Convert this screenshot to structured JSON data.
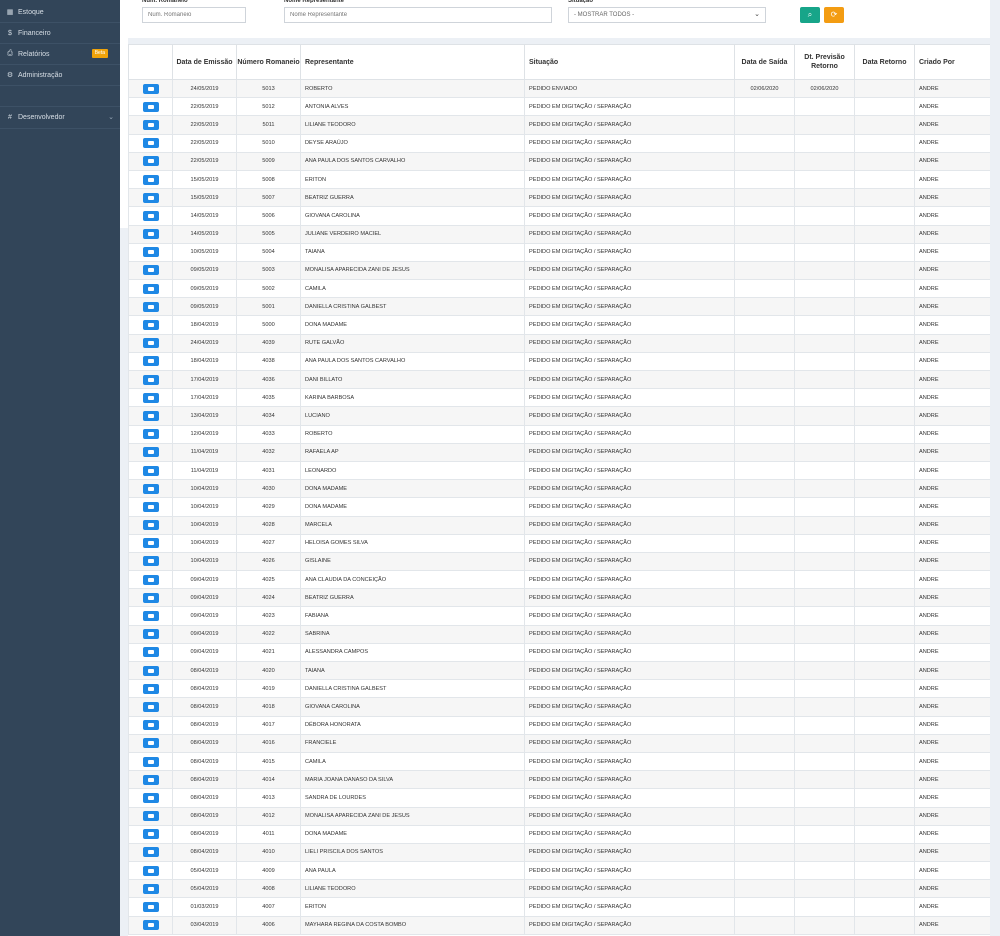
{
  "sidebar": {
    "items": [
      {
        "label": "Estoque",
        "icon": "grid-icon"
      },
      {
        "label": "Financeiro",
        "icon": "dollar-icon"
      },
      {
        "label": "Relatórios",
        "icon": "printer-icon",
        "badge": "Beta"
      },
      {
        "label": "Administração",
        "icon": "gear-icon"
      },
      {
        "label": "Desenvolvedor",
        "icon": "hash-icon"
      }
    ]
  },
  "filters": {
    "romaneio_label": "Num. Romaneio",
    "romaneio_placeholder": "Num. Romaneio",
    "representante_label": "Nome Representante",
    "representante_placeholder": "Nome Representante",
    "situacao_label": "Situação",
    "situacao_selected": "- MOSTRAR TODOS -"
  },
  "colors": {
    "sidebar": "#324559",
    "primary": "#1e88e5",
    "success": "#17a589",
    "warning": "#f39c12"
  },
  "table": {
    "headers": {
      "data_emissao": "Data de Emissão",
      "numero_romaneio": "Número Romaneio",
      "representante": "Representante",
      "situacao": "Situação",
      "data_saida": "Data de Saída",
      "dt_previsao_retorno": "Dt. Previsão Retorno",
      "data_retorno": "Data Retorno",
      "criado_por": "Criado Por"
    },
    "rows": [
      [
        "24/05/2019",
        "5013",
        "ROBERTO",
        "PEDIDO ENVIADO",
        "02/06/2020",
        "02/06/2020",
        "",
        "ANDRE"
      ],
      [
        "22/05/2019",
        "5012",
        "ANTONIA ALVES",
        "PEDIDO EM DIGITAÇÃO / SEPARAÇÃO",
        "",
        "",
        "",
        "ANDRE"
      ],
      [
        "22/05/2019",
        "5011",
        "LILIANE TEODORO",
        "PEDIDO EM DIGITAÇÃO / SEPARAÇÃO",
        "",
        "",
        "",
        "ANDRE"
      ],
      [
        "22/05/2019",
        "5010",
        "DEYSE ARAÚJO",
        "PEDIDO EM DIGITAÇÃO / SEPARAÇÃO",
        "",
        "",
        "",
        "ANDRE"
      ],
      [
        "22/05/2019",
        "5009",
        "ANA PAULA DOS SANTOS CARVALHO",
        "PEDIDO EM DIGITAÇÃO / SEPARAÇÃO",
        "",
        "",
        "",
        "ANDRE"
      ],
      [
        "15/05/2019",
        "5008",
        "ERITON",
        "PEDIDO EM DIGITAÇÃO / SEPARAÇÃO",
        "",
        "",
        "",
        "ANDRE"
      ],
      [
        "15/05/2019",
        "5007",
        "BEATRIZ GUERRA",
        "PEDIDO EM DIGITAÇÃO / SEPARAÇÃO",
        "",
        "",
        "",
        "ANDRE"
      ],
      [
        "14/05/2019",
        "5006",
        "GIOVANA CAROLINA",
        "PEDIDO EM DIGITAÇÃO / SEPARAÇÃO",
        "",
        "",
        "",
        "ANDRE"
      ],
      [
        "14/05/2019",
        "5005",
        "JULIANE VERDEIRO MACIEL",
        "PEDIDO EM DIGITAÇÃO / SEPARAÇÃO",
        "",
        "",
        "",
        "ANDRE"
      ],
      [
        "10/05/2019",
        "5004",
        "TAIANA",
        "PEDIDO EM DIGITAÇÃO / SEPARAÇÃO",
        "",
        "",
        "",
        "ANDRE"
      ],
      [
        "09/05/2019",
        "5003",
        "MONALISA APARECIDA ZANI DE JESUS",
        "PEDIDO EM DIGITAÇÃO / SEPARAÇÃO",
        "",
        "",
        "",
        "ANDRE"
      ],
      [
        "09/05/2019",
        "5002",
        "CAMILA",
        "PEDIDO EM DIGITAÇÃO / SEPARAÇÃO",
        "",
        "",
        "",
        "ANDRE"
      ],
      [
        "09/05/2019",
        "5001",
        "DANIELLA CRISTINA GALBEST",
        "PEDIDO EM DIGITAÇÃO / SEPARAÇÃO",
        "",
        "",
        "",
        "ANDRE"
      ],
      [
        "18/04/2019",
        "5000",
        "DONA MADAME",
        "PEDIDO EM DIGITAÇÃO / SEPARAÇÃO",
        "",
        "",
        "",
        "ANDRE"
      ],
      [
        "24/04/2019",
        "4039",
        "RUTE GALVÃO",
        "PEDIDO EM DIGITAÇÃO / SEPARAÇÃO",
        "",
        "",
        "",
        "ANDRE"
      ],
      [
        "18/04/2019",
        "4038",
        "ANA PAULA DOS SANTOS CARVALHO",
        "PEDIDO EM DIGITAÇÃO / SEPARAÇÃO",
        "",
        "",
        "",
        "ANDRE"
      ],
      [
        "17/04/2019",
        "4036",
        "DANI BILLATO",
        "PEDIDO EM DIGITAÇÃO / SEPARAÇÃO",
        "",
        "",
        "",
        "ANDRE"
      ],
      [
        "17/04/2019",
        "4035",
        "KARINA BARBOSA",
        "PEDIDO EM DIGITAÇÃO / SEPARAÇÃO",
        "",
        "",
        "",
        "ANDRE"
      ],
      [
        "13/04/2019",
        "4034",
        "LUCIANO",
        "PEDIDO EM DIGITAÇÃO / SEPARAÇÃO",
        "",
        "",
        "",
        "ANDRE"
      ],
      [
        "12/04/2019",
        "4033",
        "ROBERTO",
        "PEDIDO EM DIGITAÇÃO / SEPARAÇÃO",
        "",
        "",
        "",
        "ANDRE"
      ],
      [
        "11/04/2019",
        "4032",
        "RAFAELA AP",
        "PEDIDO EM DIGITAÇÃO / SEPARAÇÃO",
        "",
        "",
        "",
        "ANDRE"
      ],
      [
        "11/04/2019",
        "4031",
        "LEONARDO",
        "PEDIDO EM DIGITAÇÃO / SEPARAÇÃO",
        "",
        "",
        "",
        "ANDRE"
      ],
      [
        "10/04/2019",
        "4030",
        "DONA MADAME",
        "PEDIDO EM DIGITAÇÃO / SEPARAÇÃO",
        "",
        "",
        "",
        "ANDRE"
      ],
      [
        "10/04/2019",
        "4029",
        "DONA MADAME",
        "PEDIDO EM DIGITAÇÃO / SEPARAÇÃO",
        "",
        "",
        "",
        "ANDRE"
      ],
      [
        "10/04/2019",
        "4028",
        "MARCELA",
        "PEDIDO EM DIGITAÇÃO / SEPARAÇÃO",
        "",
        "",
        "",
        "ANDRE"
      ],
      [
        "10/04/2019",
        "4027",
        "HELOISA GOMES SILVA",
        "PEDIDO EM DIGITAÇÃO / SEPARAÇÃO",
        "",
        "",
        "",
        "ANDRE"
      ],
      [
        "10/04/2019",
        "4026",
        "GISLAINE",
        "PEDIDO EM DIGITAÇÃO / SEPARAÇÃO",
        "",
        "",
        "",
        "ANDRE"
      ],
      [
        "09/04/2019",
        "4025",
        "ANA CLAUDIA DA CONCEIÇÃO",
        "PEDIDO EM DIGITAÇÃO / SEPARAÇÃO",
        "",
        "",
        "",
        "ANDRE"
      ],
      [
        "09/04/2019",
        "4024",
        "BEATRIZ GUERRA",
        "PEDIDO EM DIGITAÇÃO / SEPARAÇÃO",
        "",
        "",
        "",
        "ANDRE"
      ],
      [
        "09/04/2019",
        "4023",
        "FABIANA",
        "PEDIDO EM DIGITAÇÃO / SEPARAÇÃO",
        "",
        "",
        "",
        "ANDRE"
      ],
      [
        "09/04/2019",
        "4022",
        "SABRINA",
        "PEDIDO EM DIGITAÇÃO / SEPARAÇÃO",
        "",
        "",
        "",
        "ANDRE"
      ],
      [
        "09/04/2019",
        "4021",
        "ALESSANDRA CAMPOS",
        "PEDIDO EM DIGITAÇÃO / SEPARAÇÃO",
        "",
        "",
        "",
        "ANDRE"
      ],
      [
        "08/04/2019",
        "4020",
        "TAIANA",
        "PEDIDO EM DIGITAÇÃO / SEPARAÇÃO",
        "",
        "",
        "",
        "ANDRE"
      ],
      [
        "08/04/2019",
        "4019",
        "DANIELLA CRISTINA GALBEST",
        "PEDIDO EM DIGITAÇÃO / SEPARAÇÃO",
        "",
        "",
        "",
        "ANDRE"
      ],
      [
        "08/04/2019",
        "4018",
        "GIOVANA CAROLINA",
        "PEDIDO EM DIGITAÇÃO / SEPARAÇÃO",
        "",
        "",
        "",
        "ANDRE"
      ],
      [
        "08/04/2019",
        "4017",
        "DÉBORA HONORATA",
        "PEDIDO EM DIGITAÇÃO / SEPARAÇÃO",
        "",
        "",
        "",
        "ANDRE"
      ],
      [
        "08/04/2019",
        "4016",
        "FRANCIELE",
        "PEDIDO EM DIGITAÇÃO / SEPARAÇÃO",
        "",
        "",
        "",
        "ANDRE"
      ],
      [
        "08/04/2019",
        "4015",
        "CAMILA",
        "PEDIDO EM DIGITAÇÃO / SEPARAÇÃO",
        "",
        "",
        "",
        "ANDRE"
      ],
      [
        "08/04/2019",
        "4014",
        "MARIA JOANA DANASO DA SILVA",
        "PEDIDO EM DIGITAÇÃO / SEPARAÇÃO",
        "",
        "",
        "",
        "ANDRE"
      ],
      [
        "08/04/2019",
        "4013",
        "SANDRA DE LOURDES",
        "PEDIDO EM DIGITAÇÃO / SEPARAÇÃO",
        "",
        "",
        "",
        "ANDRE"
      ],
      [
        "08/04/2019",
        "4012",
        "MONALISA APARECIDA ZANI DE JESUS",
        "PEDIDO EM DIGITAÇÃO / SEPARAÇÃO",
        "",
        "",
        "",
        "ANDRE"
      ],
      [
        "08/04/2019",
        "4011",
        "DONA MADAME",
        "PEDIDO EM DIGITAÇÃO / SEPARAÇÃO",
        "",
        "",
        "",
        "ANDRE"
      ],
      [
        "08/04/2019",
        "4010",
        "LIELI PRISCILA DOS SANTOS",
        "PEDIDO EM DIGITAÇÃO / SEPARAÇÃO",
        "",
        "",
        "",
        "ANDRE"
      ],
      [
        "05/04/2019",
        "4009",
        "ANA PAULA",
        "PEDIDO EM DIGITAÇÃO / SEPARAÇÃO",
        "",
        "",
        "",
        "ANDRE"
      ],
      [
        "05/04/2019",
        "4008",
        "LILIANE TEODORO",
        "PEDIDO EM DIGITAÇÃO / SEPARAÇÃO",
        "",
        "",
        "",
        "ANDRE"
      ],
      [
        "01/03/2019",
        "4007",
        "ERITON",
        "PEDIDO EM DIGITAÇÃO / SEPARAÇÃO",
        "",
        "",
        "",
        "ANDRE"
      ],
      [
        "03/04/2019",
        "4006",
        "MAYHARA REGINA DA COSTA BOMBO",
        "PEDIDO EM DIGITAÇÃO / SEPARAÇÃO",
        "",
        "",
        "",
        "ANDRE"
      ]
    ]
  }
}
